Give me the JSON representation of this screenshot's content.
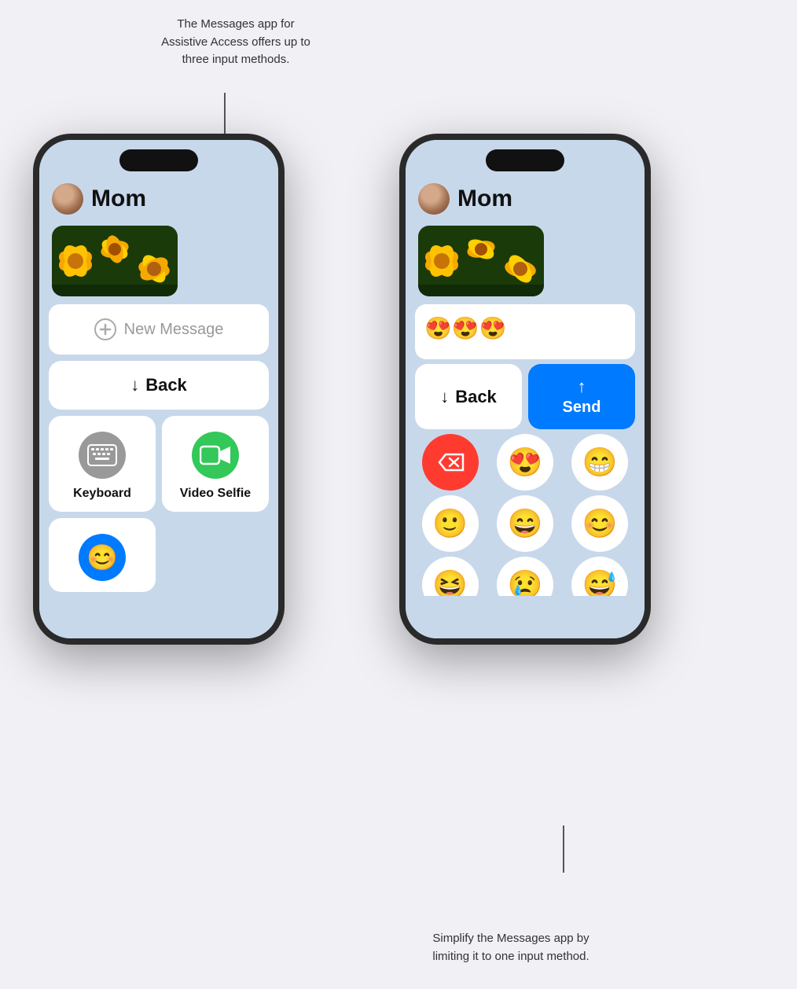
{
  "annotation_top": {
    "text": "The Messages app for Assistive Access offers up to three input methods.",
    "line_visible": true
  },
  "annotation_bottom": {
    "text": "Simplify the Messages app by limiting it to one input method.",
    "line_visible": true
  },
  "left_phone": {
    "contact": "Mom",
    "new_message_placeholder": "New Message",
    "back_label": "Back",
    "input_methods": [
      {
        "id": "keyboard",
        "label": "Keyboard",
        "icon": "keyboard",
        "color": "gray"
      },
      {
        "id": "video-selfie",
        "label": "Video Selfie",
        "icon": "video",
        "color": "green"
      }
    ],
    "partial_emoji_visible": "😊"
  },
  "right_phone": {
    "contact": "Mom",
    "composed_emojis": "😍😍😍",
    "back_label": "Back",
    "send_label": "Send",
    "emoji_grid": [
      {
        "id": "delete",
        "emoji": "⌫",
        "is_delete": true
      },
      {
        "id": "heart-eyes",
        "emoji": "😍",
        "is_delete": false
      },
      {
        "id": "grinning",
        "emoji": "😁",
        "is_delete": false
      },
      {
        "id": "slightly-smiling",
        "emoji": "🙂",
        "is_delete": false
      },
      {
        "id": "beaming",
        "emoji": "😄",
        "is_delete": false
      },
      {
        "id": "smiling-eyes",
        "emoji": "😊",
        "is_delete": false
      },
      {
        "id": "xd",
        "emoji": "😆",
        "is_delete": false
      },
      {
        "id": "cry",
        "emoji": "😢",
        "is_delete": false
      },
      {
        "id": "sweat-smile",
        "emoji": "😅",
        "is_delete": false
      }
    ]
  }
}
